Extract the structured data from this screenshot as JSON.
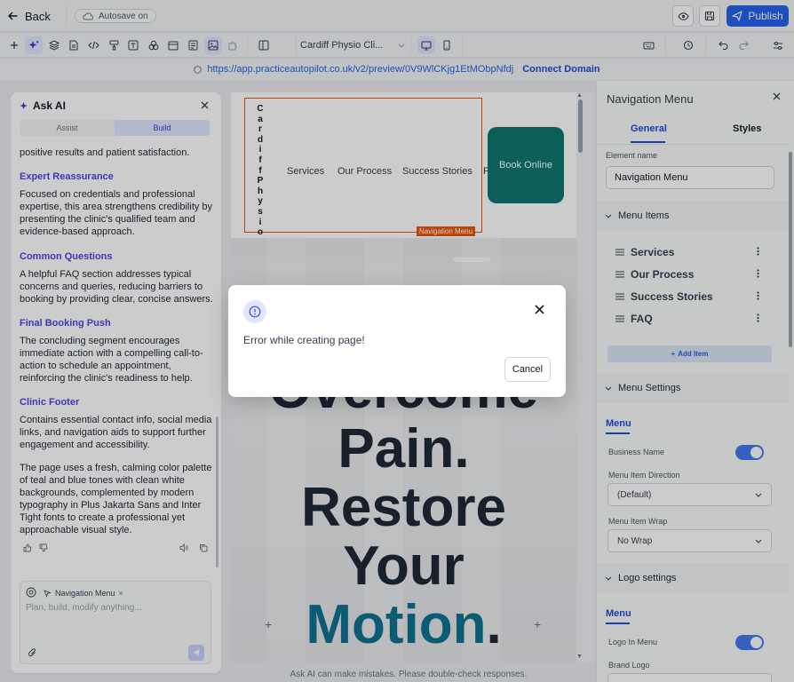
{
  "topbar": {
    "back_label": "Back",
    "autosave_label": "Autosave on",
    "publish_label": "Publish"
  },
  "toolbar": {
    "page_name": "Cardiff Physio Cli..."
  },
  "urlbar": {
    "url": "https://app.practiceautopilot.co.uk/v2/preview/0V9WlCKjg1EtMObpNfdj",
    "connect_label": "Connect Domain"
  },
  "ai_panel": {
    "title": "Ask AI",
    "tabs": [
      "Assist",
      "Build"
    ],
    "active_tab": "Build",
    "intro_fragment": "positive results and patient satisfaction.",
    "sections": [
      {
        "title": "Expert Reassurance",
        "body": "Focused on credentials and professional expertise, this area strengthens credibility by presenting the clinic's qualified team and evidence-based approach."
      },
      {
        "title": "Common Questions",
        "body": "A helpful FAQ section addresses typical concerns and queries, reducing barriers to booking by providing clear, concise answers."
      },
      {
        "title": "Final Booking Push",
        "body": "The concluding segment encourages immediate action with a compelling call-to-action to schedule an appointment, reinforcing the clinic's readiness to help."
      },
      {
        "title": "Clinic Footer",
        "body": "Contains essential contact info, social media links, and navigation aids to support further engagement and accessibility."
      }
    ],
    "summary": "The page uses a fresh, calming color palette of teal and blue tones with clean white backgrounds, complemented by modern typography in Plus Jakarta Sans and Inter Tight fonts to create a professional yet approachable visual style.",
    "context_chip": "Navigation Menu",
    "prompt_placeholder": "Plan, build, modify anything...",
    "disclaimer": "Ask AI can make mistakes. Please double-check responses."
  },
  "canvas": {
    "business_name": "Cardiff Physio",
    "nav_links": [
      "Services",
      "Our Process",
      "Success Stories",
      "FAQ"
    ],
    "selection_tag": "Navigation Menu",
    "book_button": "Book Online",
    "hero_lines": [
      "Overcome",
      "Pain.",
      "Restore",
      "Your"
    ],
    "hero_accent": "Motion",
    "hero_accent_suffix": ".",
    "accent_color": "#0e7490"
  },
  "right_panel": {
    "title": "Navigation Menu",
    "tabs": [
      "General",
      "Styles"
    ],
    "element_name_label": "Element name",
    "element_name_value": "Navigation Menu",
    "menu_items_heading": "Menu Items",
    "menu_items": [
      "Services",
      "Our Process",
      "Success Stories",
      "FAQ"
    ],
    "add_item_label": "Add Item",
    "menu_settings_heading": "Menu Settings",
    "menu_subtab": "Menu",
    "business_name_label": "Business Name",
    "menu_item_direction_label": "Menu Item Direction",
    "menu_item_direction_value": "(Default)",
    "menu_item_wrap_label": "Menu Item Wrap",
    "menu_item_wrap_value": "No Wrap",
    "logo_settings_heading": "Logo settings",
    "logo_subtab": "Menu",
    "logo_in_menu_label": "Logo In Menu",
    "brand_logo_label": "Brand Logo"
  },
  "dialog": {
    "message": "Error while creating page!",
    "cancel_label": "Cancel"
  },
  "colors": {
    "primary": "#2563eb",
    "teal": "#0f766e",
    "selection": "#ea580c"
  }
}
